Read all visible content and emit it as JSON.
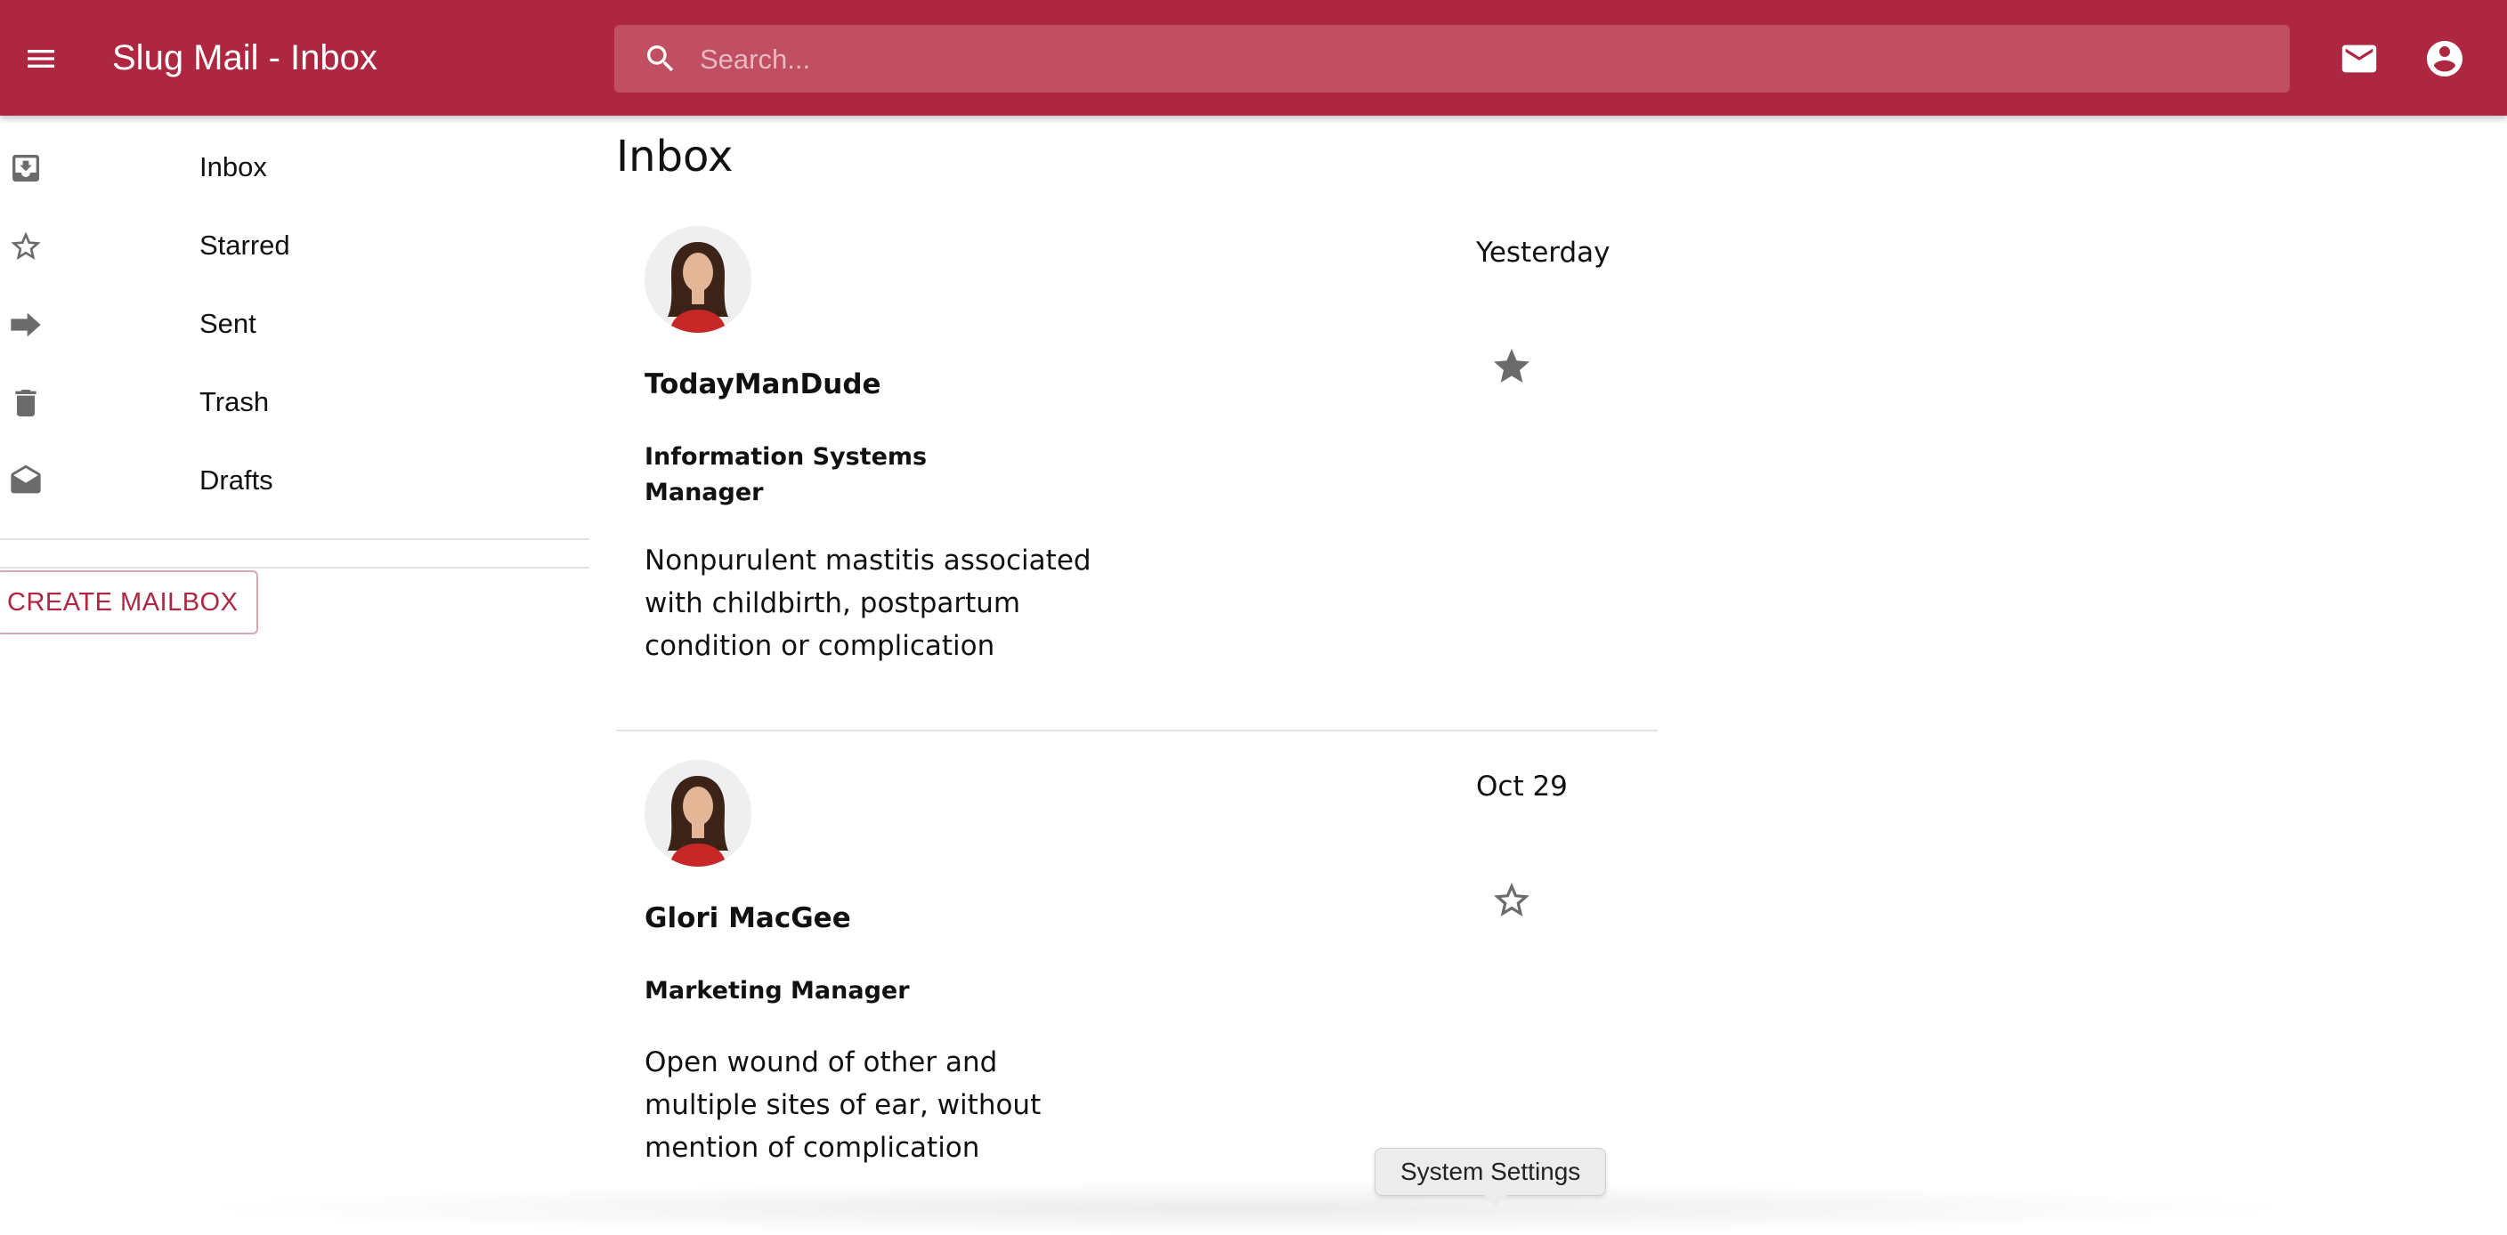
{
  "app": {
    "title": "Slug Mail - Inbox",
    "accent_color": "#ad2740",
    "menu_icon": "hamburger-menu-icon",
    "mail_icon": "envelope-icon",
    "account_icon": "account-circle-icon"
  },
  "search": {
    "placeholder": "Search...",
    "value": "",
    "icon": "search-icon"
  },
  "sidebar": {
    "items": [
      {
        "label": "Inbox",
        "icon": "inbox-icon"
      },
      {
        "label": "Starred",
        "icon": "star-outline-icon"
      },
      {
        "label": "Sent",
        "icon": "arrow-right-icon"
      },
      {
        "label": "Trash",
        "icon": "trash-icon"
      },
      {
        "label": "Drafts",
        "icon": "drafts-icon"
      }
    ],
    "create_button_label": "CREATE MAILBOX"
  },
  "main": {
    "page_title": "Inbox",
    "emails": [
      {
        "sender": "TodayManDude",
        "role": "Information Systems Manager",
        "subject": "Nonpurulent mastitis associated with childbirth, postpartum condition or complication",
        "date": "Yesterday",
        "starred": true
      },
      {
        "sender": "Glori MacGee",
        "role": "Marketing Manager",
        "subject": "Open wound of other and multiple sites of ear, without mention of complication",
        "date": "Oct 29",
        "starred": false
      }
    ]
  },
  "tooltip": {
    "text": "System Settings"
  }
}
